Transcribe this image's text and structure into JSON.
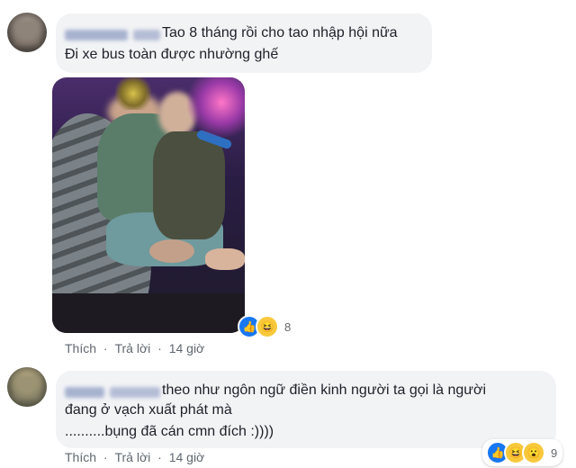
{
  "comments": [
    {
      "lines": [
        "Tao 8 tháng rồi cho tao nhập hội nữa",
        "Đi xe bus toàn được nhường ghế"
      ],
      "reaction_count": "8",
      "actions": {
        "like": "Thích",
        "reply": "Trả lời",
        "time": "14 giờ"
      }
    },
    {
      "lines": [
        "theo như ngôn ngữ điền kinh người ta gọi là người",
        "đang ở vạch xuất phát mà",
        "..........bụng đã cán cmn đích :))))"
      ],
      "reaction_count": "9",
      "actions": {
        "like": "Thích",
        "reply": "Trả lời",
        "time": "14 giờ"
      }
    }
  ],
  "icons": {
    "reaction_like": "thumbs-up-icon",
    "reaction_haha": "laughing-face-icon",
    "reaction_wow": "surprised-face-icon"
  },
  "separator": "·",
  "colors": {
    "bubble": "#f2f3f5",
    "link": "#606770",
    "like_blue": "#1877f2"
  }
}
